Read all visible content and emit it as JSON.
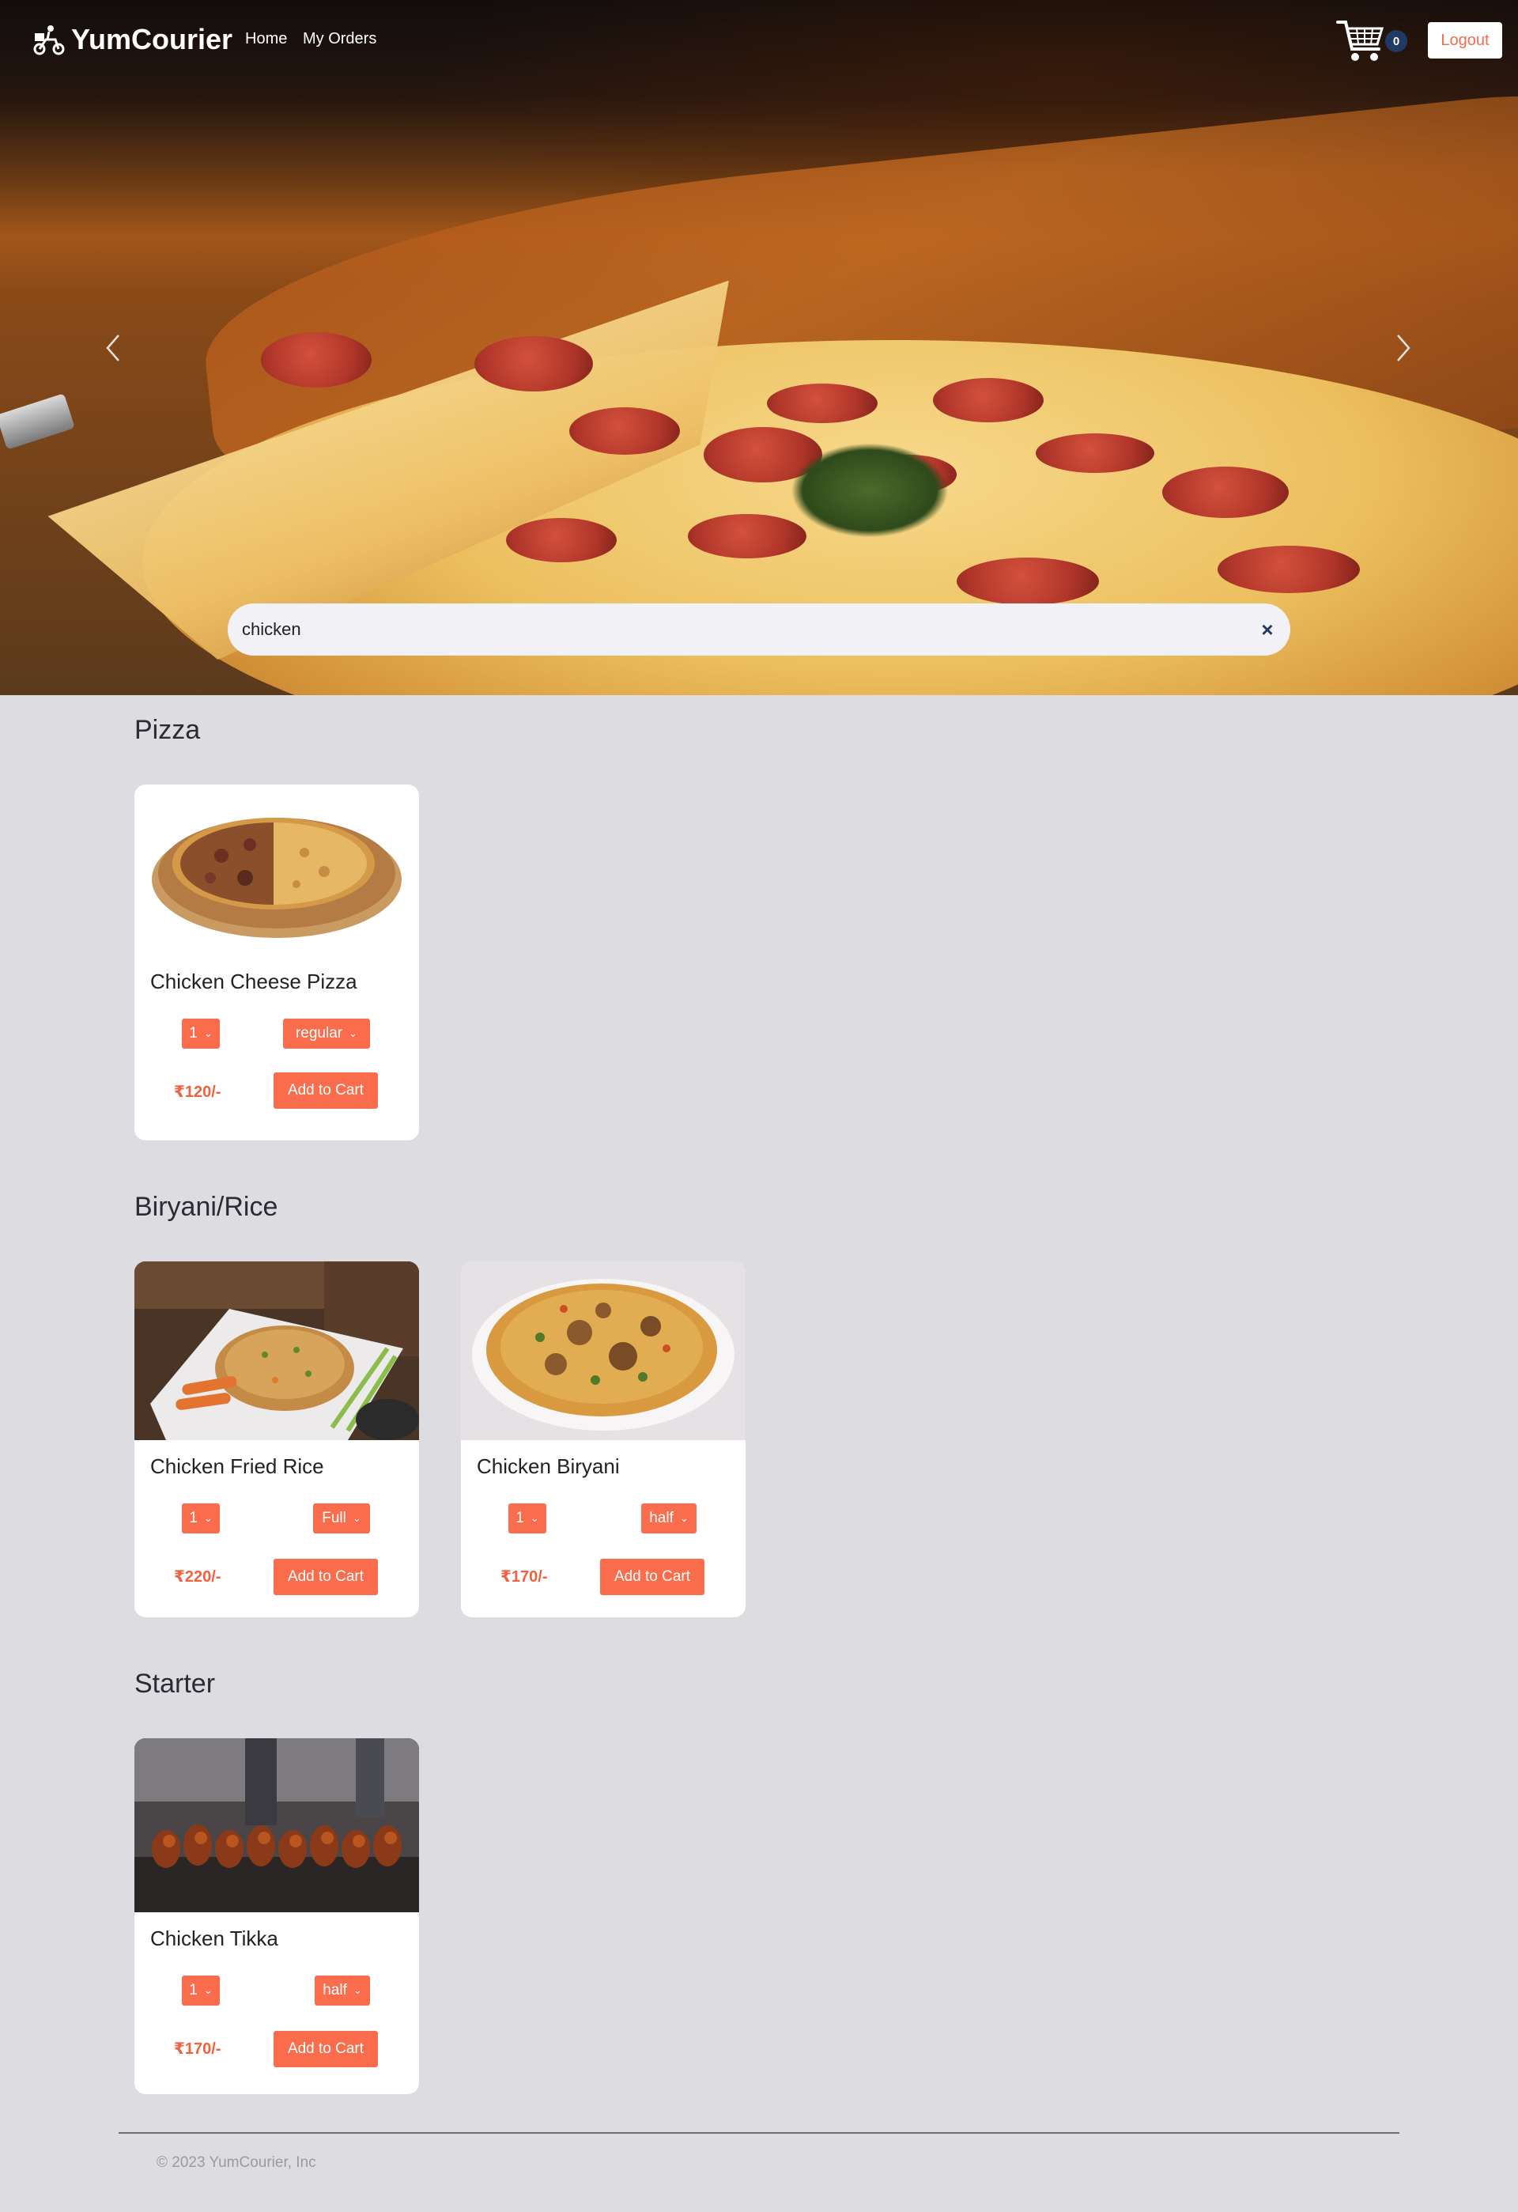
{
  "navbar": {
    "brand": "YumCourier",
    "links": [
      "Home",
      "My Orders"
    ],
    "cart_count": "0",
    "logout_label": "Logout"
  },
  "search": {
    "value": "chicken",
    "clear_glyph": "×"
  },
  "icons": {
    "brand": "delivery-scooter-icon",
    "cart": "shopping-cart-icon",
    "prev": "chevron-left-icon",
    "next": "chevron-right-icon",
    "clear": "close-icon",
    "dropdown": "chevron-down-icon"
  },
  "colors": {
    "accent": "#fa6d4c",
    "price": "#f1603f",
    "badge": "#1f3a63",
    "page_bg": "#dcdce1"
  },
  "categories": [
    {
      "title": "Pizza",
      "items": [
        {
          "name": "Chicken Cheese Pizza",
          "qty": "1",
          "size": "regular",
          "price": "₹120/-",
          "add_label": "Add to Cart"
        }
      ]
    },
    {
      "title": "Biryani/Rice",
      "items": [
        {
          "name": "Chicken Fried Rice",
          "qty": "1",
          "size": "Full",
          "price": "₹220/-",
          "add_label": "Add to Cart"
        },
        {
          "name": "Chicken Biryani",
          "qty": "1",
          "size": "half",
          "price": "₹170/-",
          "add_label": "Add to Cart"
        }
      ]
    },
    {
      "title": "Starter",
      "items": [
        {
          "name": "Chicken Tikka",
          "qty": "1",
          "size": "half",
          "price": "₹170/-",
          "add_label": "Add to Cart"
        }
      ]
    }
  ],
  "footer": {
    "copyright": "© 2023 YumCourier, Inc"
  }
}
